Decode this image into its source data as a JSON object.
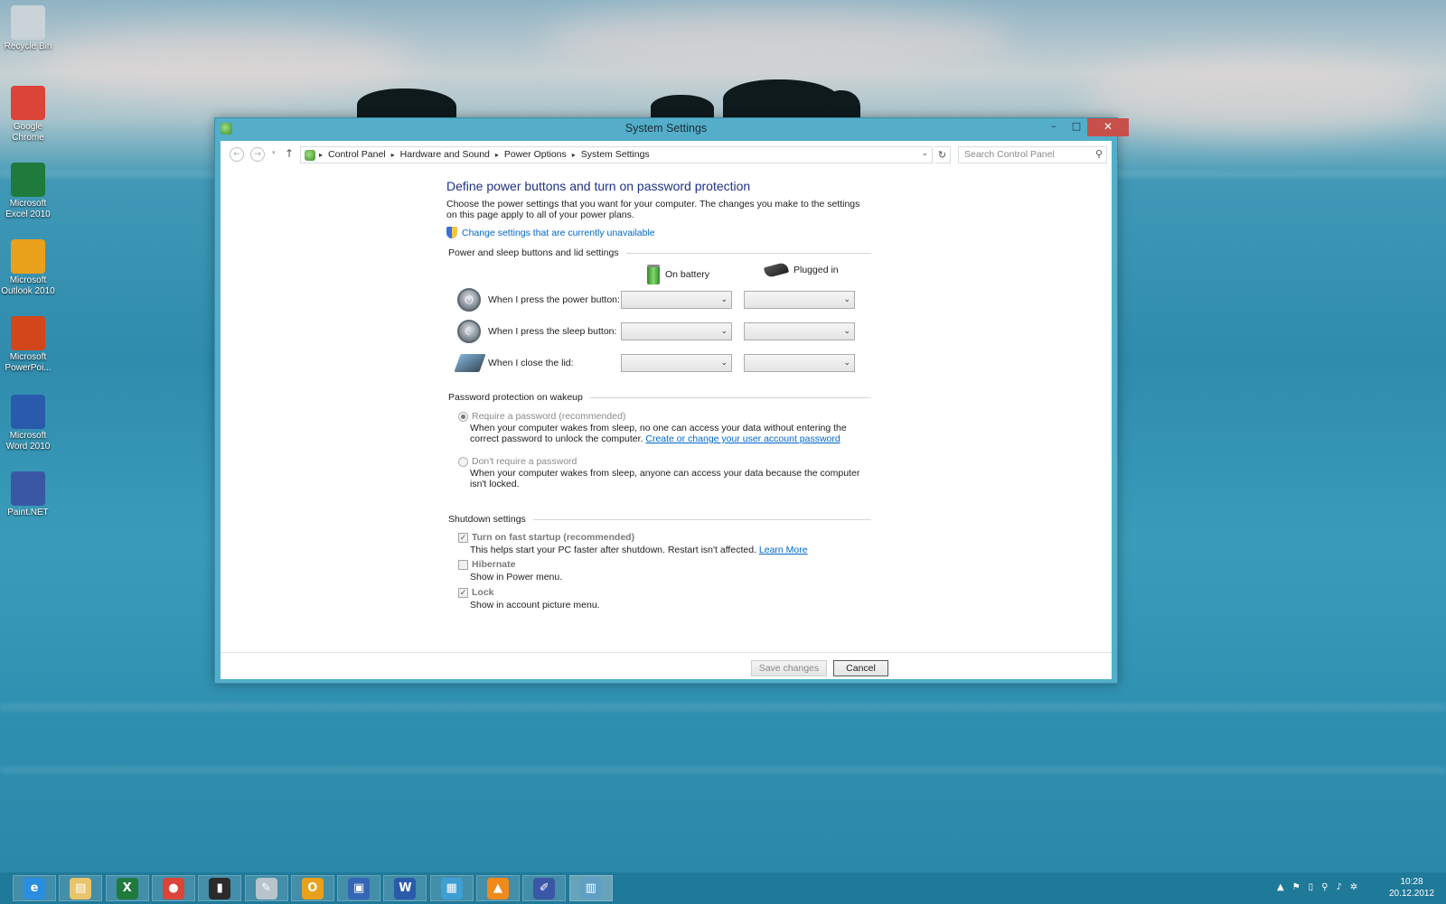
{
  "desktop": {
    "icons": [
      {
        "label": "Recycle Bin",
        "icon": "recycle-bin-icon",
        "color": "#c9d3d8"
      },
      {
        "label": "Google Chrome",
        "icon": "chrome-icon",
        "color": "#db4437"
      },
      {
        "label": "Microsoft Excel 2010",
        "icon": "excel-icon",
        "color": "#1e7b3c"
      },
      {
        "label": "Microsoft Outlook 2010",
        "icon": "outlook-icon",
        "color": "#e9a01a"
      },
      {
        "label": "Microsoft PowerPoi...",
        "icon": "powerpoint-icon",
        "color": "#d2461b"
      },
      {
        "label": "Microsoft Word 2010",
        "icon": "word-icon",
        "color": "#2a5aab"
      },
      {
        "label": "Paint.NET",
        "icon": "paintnet-icon",
        "color": "#3a57a6"
      }
    ]
  },
  "window": {
    "title": "System Settings",
    "controls": {
      "minimize": "–",
      "maximize": "□",
      "close": "✕"
    },
    "nav": {
      "back": "←",
      "forward": "→",
      "recent": "▾",
      "up": "↑"
    },
    "breadcrumb": [
      "Control Panel",
      "Hardware and Sound",
      "Power Options",
      "System Settings"
    ],
    "search_placeholder": "Search Control Panel"
  },
  "page": {
    "heading": "Define power buttons and turn on password protection",
    "description": "Choose the power settings that you want for your computer. The changes you make to the settings on this page apply to all of your power plans.",
    "change_settings_link": "Change settings that are currently unavailable",
    "power_section": {
      "title": "Power and sleep buttons and lid settings",
      "col_battery": "On battery",
      "col_plugged": "Plugged in",
      "rows": [
        {
          "label": "When I press the power button:",
          "battery": "",
          "plugged": ""
        },
        {
          "label": "When I press the sleep button:",
          "battery": "",
          "plugged": ""
        },
        {
          "label": "When I close the lid:",
          "battery": "",
          "plugged": ""
        }
      ]
    },
    "password_section": {
      "title": "Password protection on wakeup",
      "require_label": "Require a password (recommended)",
      "require_text": "When your computer wakes from sleep, no one can access your data without entering the correct password to unlock the computer.",
      "require_link": "Create or change your user account password",
      "require_selected": true,
      "dont_label": "Don't require a password",
      "dont_text": "When your computer wakes from sleep, anyone can access your data because the computer isn't locked.",
      "dont_selected": false
    },
    "shutdown_section": {
      "title": "Shutdown settings",
      "items": [
        {
          "label": "Turn on fast startup (recommended)",
          "checked": true,
          "text": "This helps start your PC faster after shutdown. Restart isn't affected.",
          "link": "Learn More"
        },
        {
          "label": "Hibernate",
          "checked": false,
          "text": "Show in Power menu.",
          "link": ""
        },
        {
          "label": "Lock",
          "checked": true,
          "text": "Show in account picture menu.",
          "link": ""
        }
      ]
    },
    "buttons": {
      "save": "Save changes",
      "cancel": "Cancel"
    }
  },
  "taskbar": {
    "items": [
      {
        "name": "internet-explorer",
        "glyph": "e",
        "color": "#2a8de0"
      },
      {
        "name": "file-explorer",
        "glyph": "▤",
        "color": "#e9c46a"
      },
      {
        "name": "excel",
        "glyph": "X",
        "color": "#1e7b3c"
      },
      {
        "name": "chrome",
        "glyph": "●",
        "color": "#db4437"
      },
      {
        "name": "cmd",
        "glyph": "▮",
        "color": "#2b2b2b"
      },
      {
        "name": "notepad",
        "glyph": "✎",
        "color": "#b8c4cc"
      },
      {
        "name": "outlook",
        "glyph": "O",
        "color": "#e9a01a"
      },
      {
        "name": "remote-desktop",
        "glyph": "▣",
        "color": "#3466b5"
      },
      {
        "name": "word",
        "glyph": "W",
        "color": "#2a5aab"
      },
      {
        "name": "network-drive",
        "glyph": "▦",
        "color": "#3d9fd4"
      },
      {
        "name": "vlc",
        "glyph": "▲",
        "color": "#f08a1c"
      },
      {
        "name": "paint-net",
        "glyph": "✐",
        "color": "#3a57a6"
      },
      {
        "name": "control-panel",
        "glyph": "▥",
        "color": "#5f9fc4"
      }
    ],
    "tray": [
      "▲",
      "⚑",
      "▯",
      "⚲",
      "♪",
      "✲"
    ],
    "time": "10:28",
    "date": "20.12.2012"
  }
}
